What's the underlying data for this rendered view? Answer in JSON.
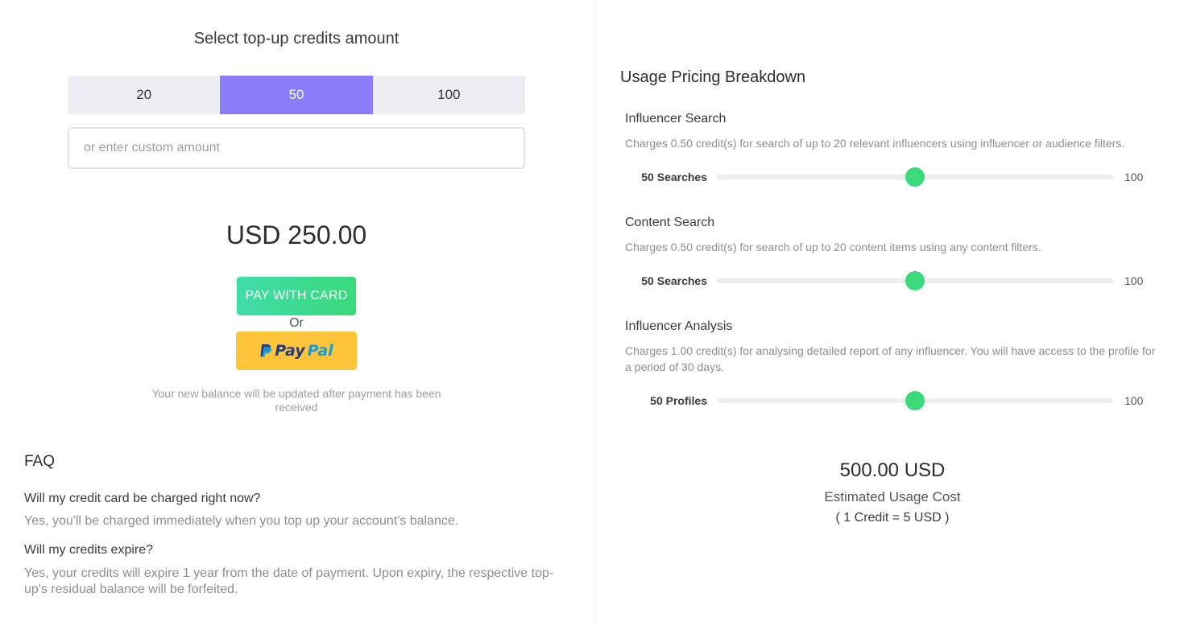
{
  "topup": {
    "title": "Select top-up credits amount",
    "options": [
      "20",
      "50",
      "100"
    ],
    "selected": "50",
    "custom_placeholder": "or enter custom amount",
    "price": "USD 250.00",
    "pay_card_label": "PAY WITH CARD",
    "or_label": "Or",
    "paypal": {
      "pay": "Pay",
      "pal": "Pal"
    },
    "balance_note": "Your new balance will be updated after payment has been received"
  },
  "faq": {
    "title": "FAQ",
    "items": [
      {
        "q": "Will my credit card be charged right now?",
        "a": "Yes, you'll be charged immediately when you top up your account's balance."
      },
      {
        "q": "Will my credits expire?",
        "a": "Yes, your credits will expire 1 year from the date of payment. Upon expiry, the respective top-up's residual balance will be forfeited."
      }
    ]
  },
  "usage": {
    "title": "Usage Pricing Breakdown",
    "sections": [
      {
        "title": "Influencer Search",
        "desc": "Charges 0.50 credit(s) for search of up to 20 relevant influencers using influencer or audience filters.",
        "slider_label": "50 Searches",
        "value": 50,
        "max": 100,
        "max_label": "100"
      },
      {
        "title": "Content Search",
        "desc": "Charges 0.50 credit(s) for search of up to 20 content items using any content filters.",
        "slider_label": "50 Searches",
        "value": 50,
        "max": 100,
        "max_label": "100"
      },
      {
        "title": "Influencer Analysis",
        "desc": "Charges 1.00 credit(s) for analysing detailed report of any influencer. You will have access to the profile for a period of 30 days.",
        "slider_label": "50 Profiles",
        "value": 50,
        "max": 100,
        "max_label": "100"
      }
    ],
    "estimate_value": "500.00 USD",
    "estimate_label": "Estimated Usage Cost",
    "rate": "( 1 Credit = 5 USD )"
  },
  "colors": {
    "accent_purple": "#8a7cfb",
    "accent_green": "#3ad97a",
    "paypal_yellow": "#ffc439"
  }
}
